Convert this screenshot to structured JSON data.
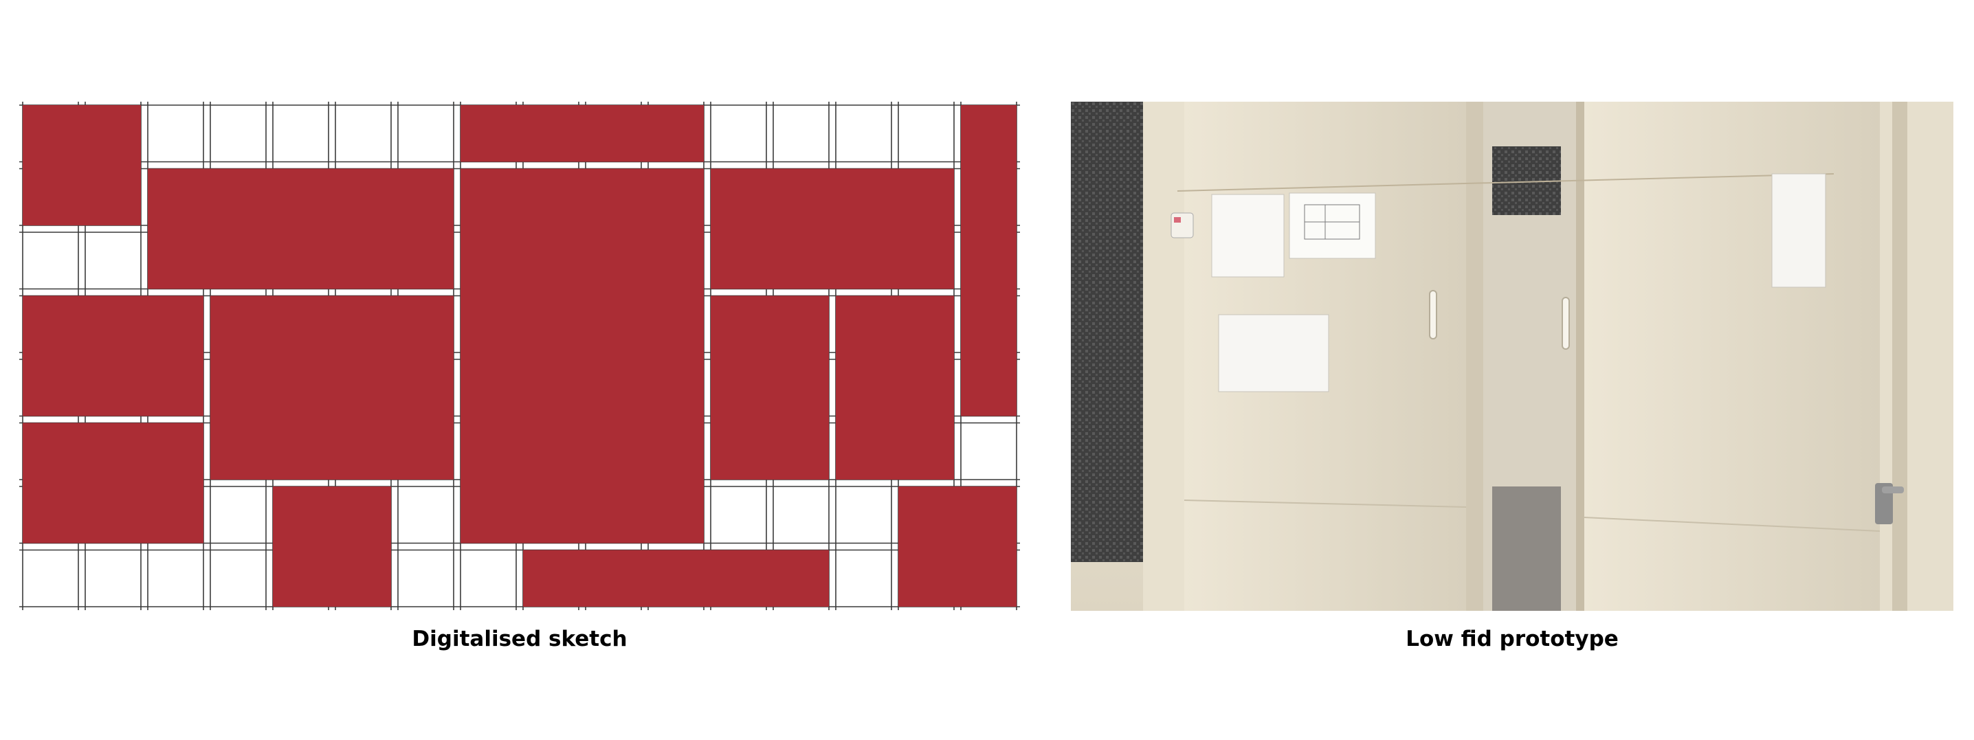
{
  "left_caption": "Digitalised sketch",
  "right_caption": "Low fid prototype",
  "colors": {
    "block": "#ab2d35",
    "grid_line": "#3a3a3a",
    "background": "#ffffff",
    "wall": "#efe9db",
    "door": "#e2dccc",
    "dark_tile": "#3a3a3a"
  }
}
